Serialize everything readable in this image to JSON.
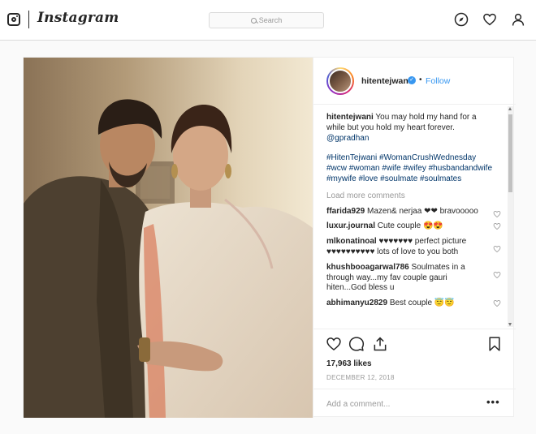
{
  "nav": {
    "wordmark": "Instagram",
    "search_placeholder": "Search"
  },
  "post": {
    "username": "hitentejwani",
    "verified_icon": "verified-badge",
    "separator": "•",
    "follow_label": "Follow",
    "caption_user": "hitentejwani",
    "caption_text": " You may hold my hand for a while but you hold my heart forever. ",
    "caption_mention": "@gpradhan",
    "hashtags": "#HitenTejwani #WomanCrushWednesday #wcw #woman #wife #wifey #husbandandwife #mywife #love #soulmate #soulmates",
    "load_more": "Load more comments",
    "comments": [
      {
        "user": "ffarida929",
        "text": " Mazen& nerjaa ❤❤ bravooooo"
      },
      {
        "user": "luxur.journal",
        "text": " Cute couple 😍😍"
      },
      {
        "user": "mlkonatinoal",
        "text": " ♥♥♥♥♥♥♥ perfect picture ♥♥♥♥♥♥♥♥♥♥ lots of love to you both"
      },
      {
        "user": "khushbooagarwal786",
        "text": " Soulmates in a through way...my fav couple gauri hiten...God bless u"
      },
      {
        "user": "abhimanyu2829",
        "text": " Best couple 😇😇"
      }
    ],
    "likes": "17,963 likes",
    "date": "DECEMBER 12, 2018",
    "add_comment_placeholder": "Add a comment...",
    "more_options": "•••"
  },
  "colors": {
    "link_blue": "#3897f0",
    "hashtag_navy": "#003569",
    "border": "#dbdbdb",
    "muted": "#999999"
  }
}
